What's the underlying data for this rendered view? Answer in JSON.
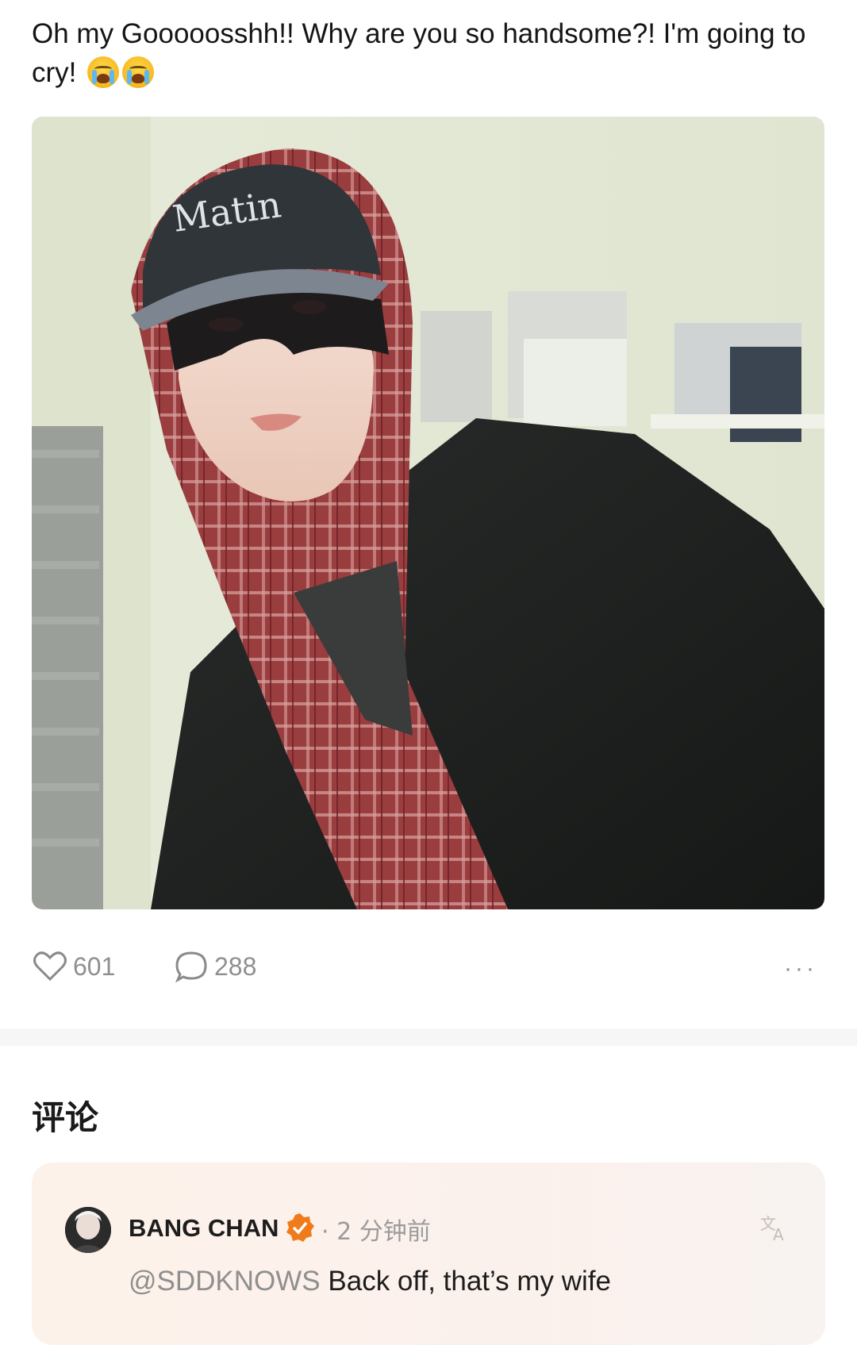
{
  "post": {
    "text": "Oh my Gooooosshh!! Why are you so handsome?! I'm going to cry!",
    "emojis": [
      "loudly-crying-face",
      "loudly-crying-face"
    ],
    "photo": {
      "cap_text": "Matin",
      "description_icon": "photo"
    }
  },
  "actions": {
    "like_count": "601",
    "comment_count": "288",
    "more_label": "···"
  },
  "comments_section": {
    "title": "评论"
  },
  "comment": {
    "author": "BANG CHAN",
    "verified": true,
    "time": "· 2 分钟前",
    "mention": "@SDDKNOWS",
    "text": "Back off, that’s my wife"
  },
  "colors": {
    "verified_badge": "#f07b1a",
    "card_bg": "#fdf2ea",
    "muted_text": "#8f8f8f"
  }
}
